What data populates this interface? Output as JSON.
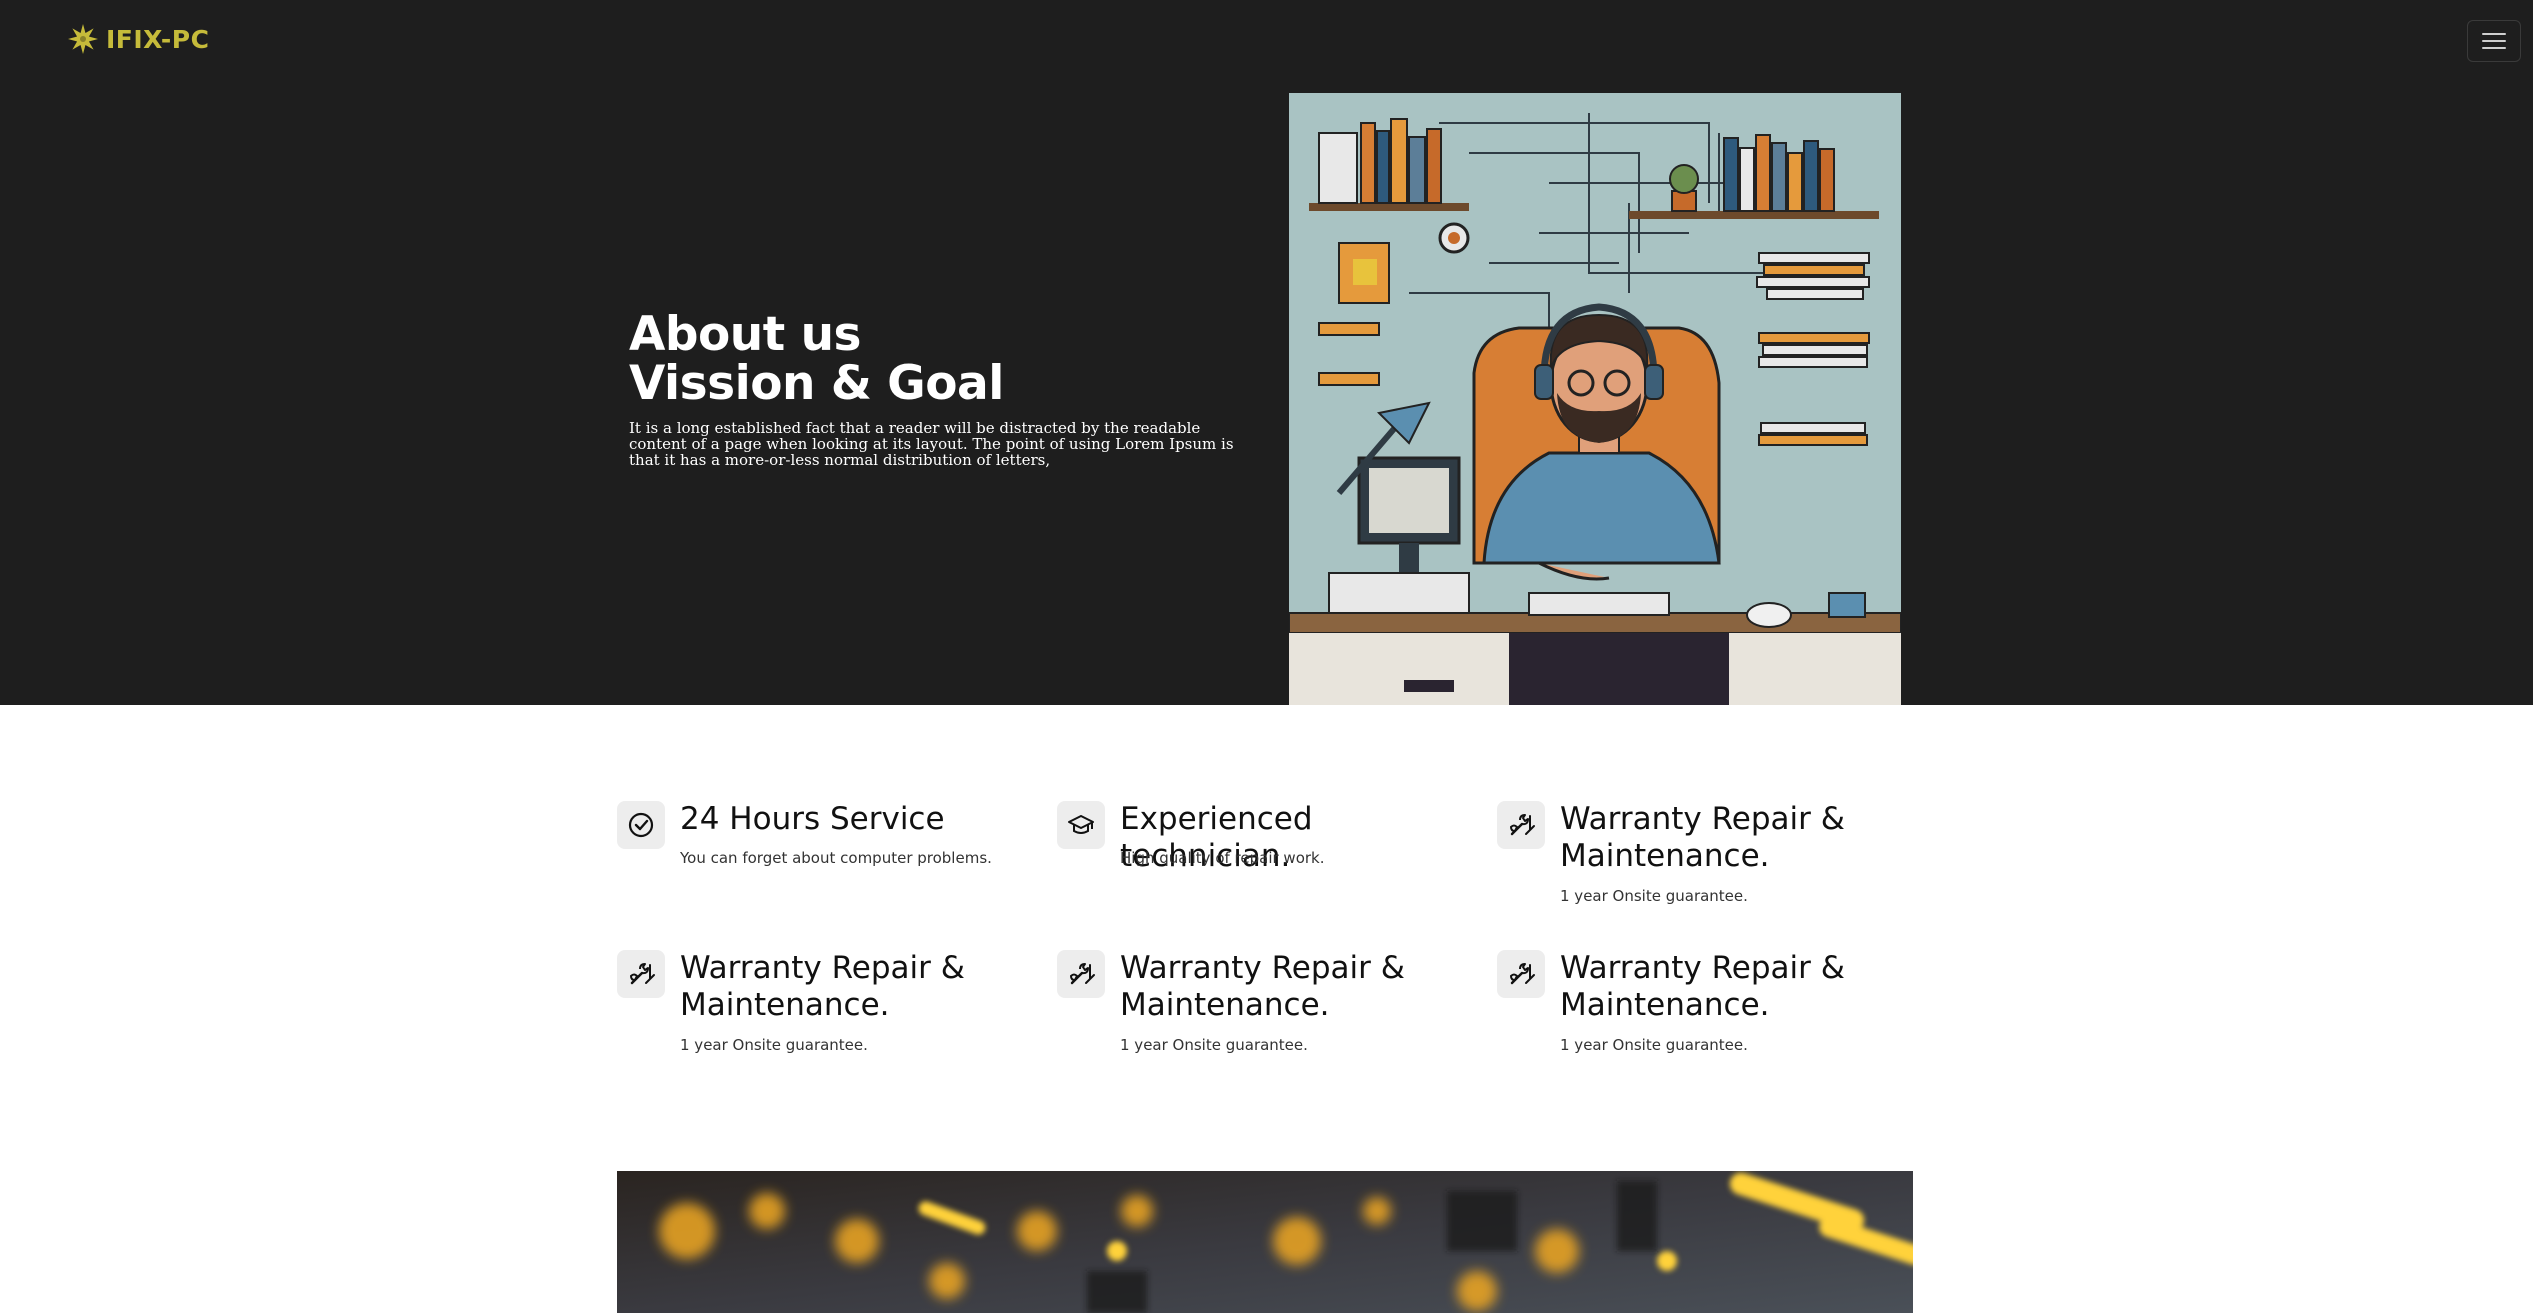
{
  "brand": {
    "name": "IFIX-PC",
    "color": "#c6bb3a",
    "icon": "sunburst-logo-icon"
  },
  "nav": {
    "toggler_icon": "hamburger-menu-icon"
  },
  "hero": {
    "title_line1": "About us",
    "title_line2": "Vission & Goal",
    "description": "It is a long established fact that a reader will be distracted by the readable content of a page when looking at its layout. The point of using Lorem Ipsum is that it has a more-or-less normal distribution of letters,",
    "background": "#1e1e1e",
    "illustration": "technician-at-desk-illustration"
  },
  "features": [
    {
      "title": "24 Hours Service",
      "desc": "You can forget about computer problems.",
      "icon": "check-circle-icon"
    },
    {
      "title": "Experienced technician.",
      "desc": "High quality of repair work.",
      "icon": "graduation-cap-icon"
    },
    {
      "title": "Warranty Repair & Maintenance.",
      "desc": "1 year Onsite guarantee.",
      "icon": "tools-icon"
    },
    {
      "title": "Warranty Repair & Maintenance.",
      "desc": "1 year Onsite guarantee.",
      "icon": "tools-icon"
    },
    {
      "title": "Warranty Repair & Maintenance.",
      "desc": "1 year Onsite guarantee.",
      "icon": "tools-icon"
    },
    {
      "title": "Warranty Repair & Maintenance.",
      "desc": "1 year Onsite guarantee.",
      "icon": "tools-icon"
    }
  ],
  "banner": {
    "image": "circuit-board-bokeh-image"
  }
}
